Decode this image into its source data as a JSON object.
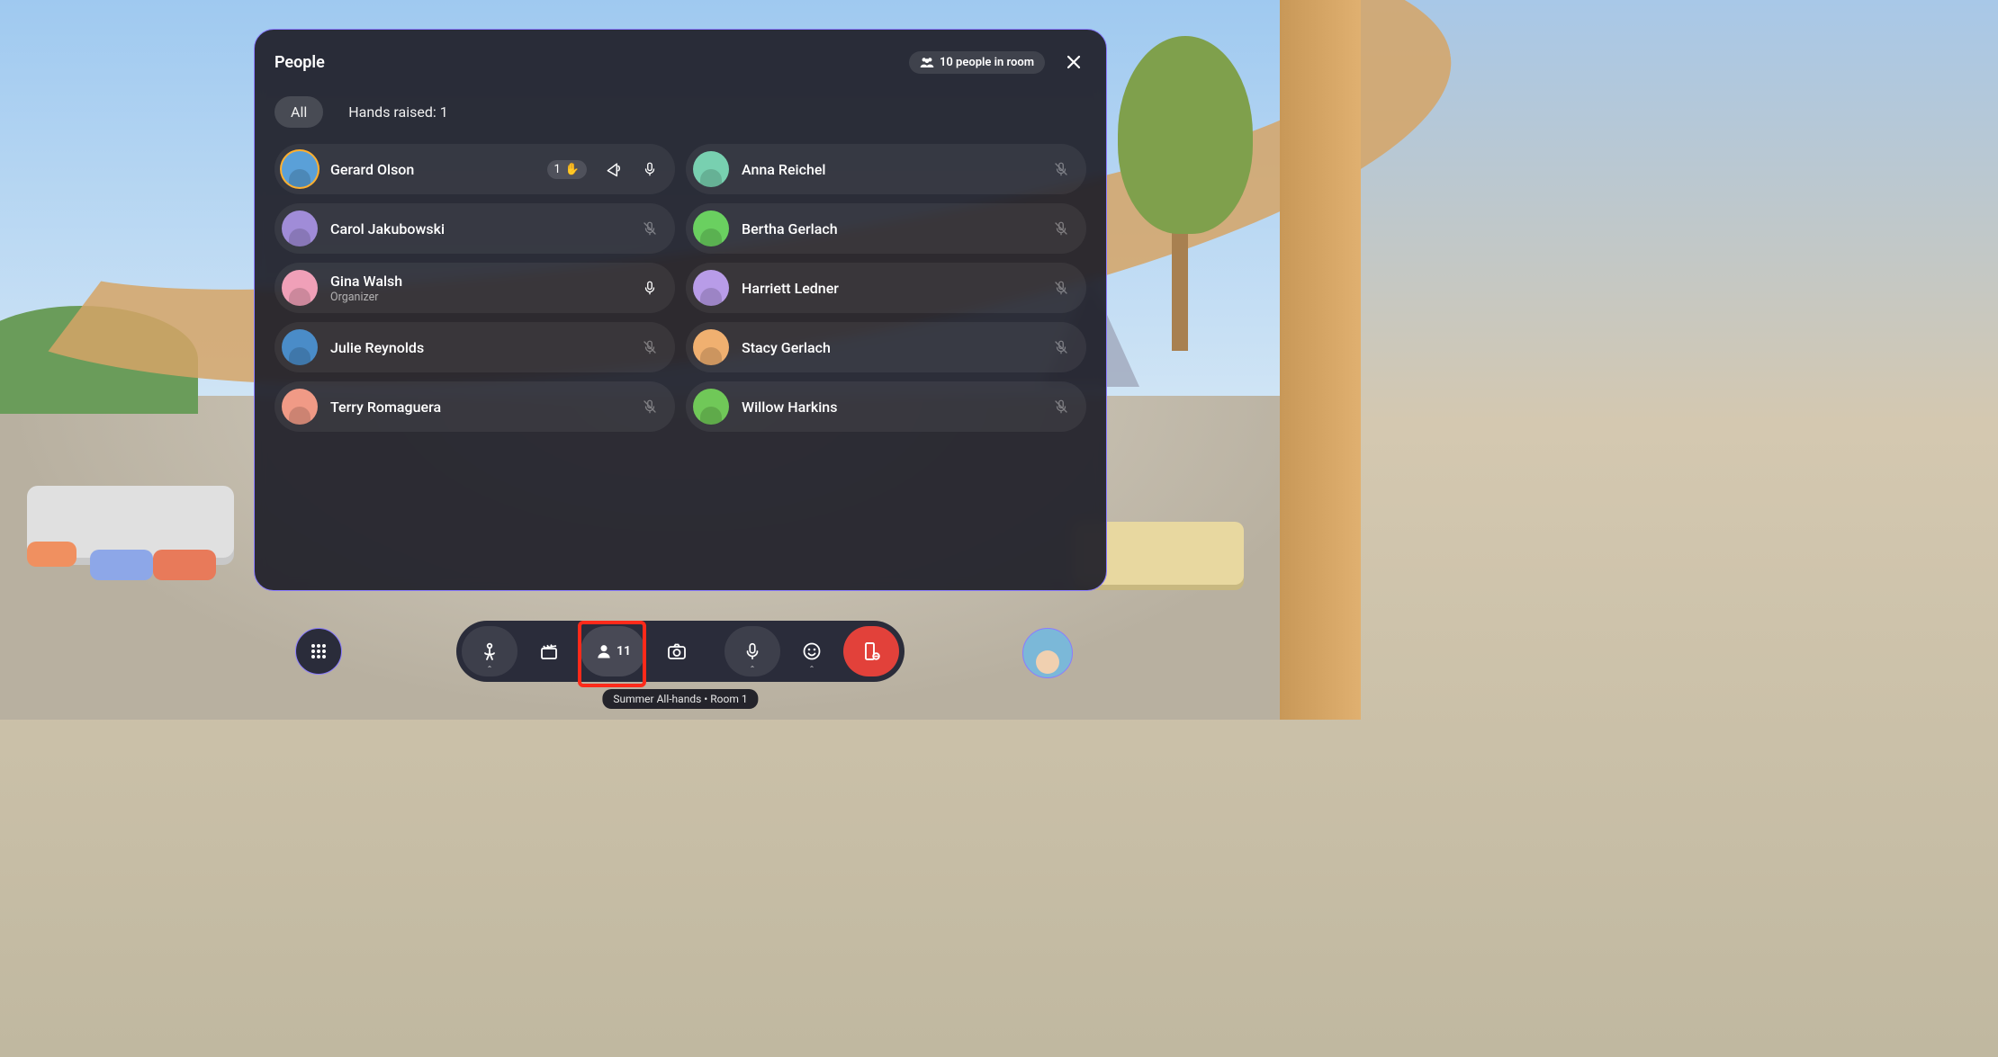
{
  "panel": {
    "title": "People",
    "room_count_label": "10 people in room",
    "tabs": {
      "all": "All",
      "hands_raised": "Hands raised: 1"
    },
    "active_tab": "all"
  },
  "people": {
    "left": [
      {
        "name": "Gerard Olson",
        "subtitle": "",
        "avatar_bg": "#5aa0d8",
        "ring": true,
        "hand_raised": true,
        "hand_order": "1",
        "megaphone": true,
        "mic": "on"
      },
      {
        "name": "Carol Jakubowski",
        "subtitle": "",
        "avatar_bg": "#a08cd8",
        "ring": false,
        "hand_raised": false,
        "megaphone": false,
        "mic": "off"
      },
      {
        "name": "Gina Walsh",
        "subtitle": "Organizer",
        "avatar_bg": "#f0a0b8",
        "ring": false,
        "hand_raised": false,
        "megaphone": false,
        "mic": "on"
      },
      {
        "name": "Julie Reynolds",
        "subtitle": "",
        "avatar_bg": "#4a8cc8",
        "ring": false,
        "hand_raised": false,
        "megaphone": false,
        "mic": "off"
      },
      {
        "name": "Terry Romaguera",
        "subtitle": "",
        "avatar_bg": "#f09a86",
        "ring": false,
        "hand_raised": false,
        "megaphone": false,
        "mic": "off"
      }
    ],
    "right": [
      {
        "name": "Anna Reichel",
        "subtitle": "",
        "avatar_bg": "#78d0b0",
        "ring": false,
        "hand_raised": false,
        "megaphone": false,
        "mic": "off"
      },
      {
        "name": "Bertha Gerlach",
        "subtitle": "",
        "avatar_bg": "#6ad060",
        "ring": false,
        "hand_raised": false,
        "megaphone": false,
        "mic": "off"
      },
      {
        "name": "Harriett Ledner",
        "subtitle": "",
        "avatar_bg": "#b89ce8",
        "ring": false,
        "hand_raised": false,
        "megaphone": false,
        "mic": "off"
      },
      {
        "name": "Stacy Gerlach",
        "subtitle": "",
        "avatar_bg": "#f0b070",
        "ring": false,
        "hand_raised": false,
        "megaphone": false,
        "mic": "off"
      },
      {
        "name": "Willow Harkins",
        "subtitle": "",
        "avatar_bg": "#70c858",
        "ring": false,
        "hand_raised": false,
        "megaphone": false,
        "mic": "off"
      }
    ]
  },
  "toolbar": {
    "people_count": "11",
    "highlighted": "people"
  },
  "room_label": "Summer All-hands • Room 1"
}
